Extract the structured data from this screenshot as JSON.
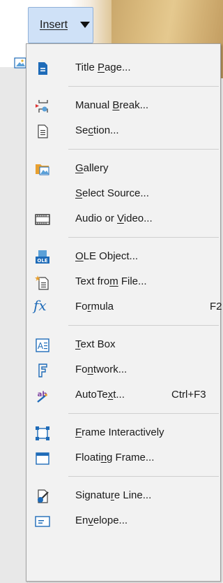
{
  "toolbar": {
    "insert_label": "Insert"
  },
  "menu": {
    "items": [
      {
        "pre": "Title ",
        "ul": "P",
        "post": "age...",
        "shortcut": ""
      },
      {
        "pre": "Manual ",
        "ul": "B",
        "post": "reak...",
        "shortcut": ""
      },
      {
        "pre": "Se",
        "ul": "c",
        "post": "tion...",
        "shortcut": ""
      },
      {
        "pre": "",
        "ul": "G",
        "post": "allery",
        "shortcut": ""
      },
      {
        "pre": "",
        "ul": "S",
        "post": "elect Source...",
        "shortcut": ""
      },
      {
        "pre": "Audio or ",
        "ul": "V",
        "post": "ideo...",
        "shortcut": ""
      },
      {
        "pre": "",
        "ul": "O",
        "post": "LE Object...",
        "shortcut": ""
      },
      {
        "pre": "Text fro",
        "ul": "m",
        "post": " File...",
        "shortcut": ""
      },
      {
        "pre": "Fo",
        "ul": "r",
        "post": "mula",
        "shortcut": "F2"
      },
      {
        "pre": "",
        "ul": "T",
        "post": "ext Box",
        "shortcut": ""
      },
      {
        "pre": "Fo",
        "ul": "n",
        "post": "twork...",
        "shortcut": ""
      },
      {
        "pre": "AutoTe",
        "ul": "x",
        "post": "t...",
        "shortcut": "Ctrl+F3"
      },
      {
        "pre": "",
        "ul": "F",
        "post": "rame Interactively",
        "shortcut": ""
      },
      {
        "pre": "Floati",
        "ul": "n",
        "post": "g Frame...",
        "shortcut": ""
      },
      {
        "pre": "Signatu",
        "ul": "r",
        "post": "e Line...",
        "shortcut": ""
      },
      {
        "pre": "En",
        "ul": "v",
        "post": "elope...",
        "shortcut": ""
      }
    ]
  },
  "icons": {
    "title_page": "title-page-icon",
    "manual_break": "manual-break-icon",
    "section": "section-icon",
    "gallery": "gallery-icon",
    "audio_video": "media-icon",
    "ole": "ole-object-icon",
    "text_from_file": "text-from-file-icon",
    "formula": "formula-icon",
    "text_box": "text-box-icon",
    "fontwork": "fontwork-icon",
    "autotext": "autotext-icon",
    "frame": "frame-interactively-icon",
    "floating_frame": "floating-frame-icon",
    "signature": "signature-line-icon",
    "envelope": "envelope-icon",
    "formula_glyph": "fx"
  },
  "colors": {
    "accent": "#1e6bb8",
    "button_bg": "#cfe1f7",
    "menu_bg": "#f2f2f2"
  }
}
